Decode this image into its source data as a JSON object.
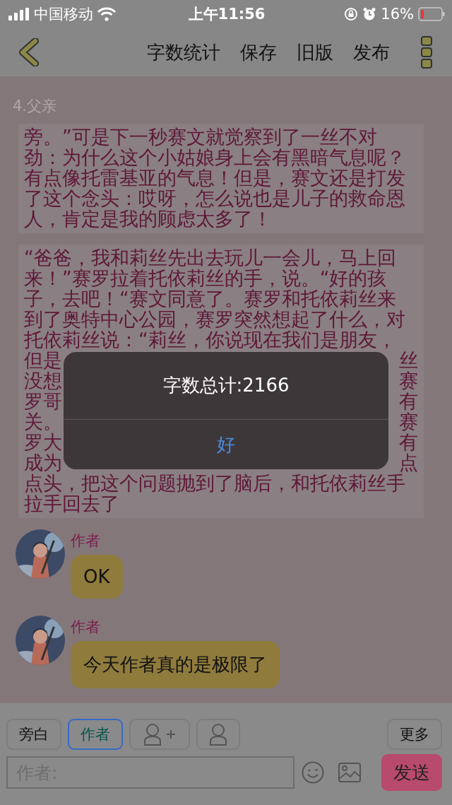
{
  "status_bar": {
    "carrier": "中国移动",
    "time": "上午11:56",
    "battery": "16%"
  },
  "toolbar": {
    "actions": [
      "字数统计",
      "保存",
      "旧版",
      "发布"
    ]
  },
  "chapter_title": "4.父亲",
  "paragraphs": [
    {
      "lines": [
        {
          "text": "旁。”可是下一秒赛文就觉察到了一丝不对"
        },
        {
          "text": "劲：为什么这个小姑娘身上会有黑暗气息呢？"
        },
        {
          "text": "有点像托雷基亚的气息！但是，赛文还是打发"
        },
        {
          "text": "了这个念头：哎呀，怎么说也是儿子的救命恩"
        },
        {
          "text": "人，肯定是我的顾虑太多了！"
        }
      ]
    },
    {
      "lines": [
        {
          "text": "“爸爸，我和莉丝先出去玩儿一会儿，马上回"
        },
        {
          "text": "来！”赛罗拉着托依莉丝的手，说。“好的孩"
        },
        {
          "text": "子，去吧！“赛文同意了。赛罗和托依莉丝来"
        },
        {
          "text": "到了奥特中心公园，赛罗突然想起了什么，对"
        },
        {
          "text": "托依莉丝说：“莉丝，你说现在我们是朋友，"
        },
        {
          "left": "但是",
          "right": "丝"
        },
        {
          "left": "没想",
          "right": "赛"
        },
        {
          "left": "罗哥",
          "right": "有"
        },
        {
          "left": "关。",
          "right": "赛"
        },
        {
          "left": "罗大",
          "right": "有"
        },
        {
          "left": "成为",
          "right": "点"
        },
        {
          "text": "点头，把这个问题抛到了脑后，和托依莉丝手"
        },
        {
          "text": "拉手回去了"
        }
      ]
    }
  ],
  "messages": [
    {
      "author": "作者",
      "text": "OK"
    },
    {
      "author": "作者",
      "text": "今天作者真的是极限了"
    }
  ],
  "roles": [
    {
      "label": "旁白",
      "selected": false
    },
    {
      "label": "作者",
      "selected": true
    }
  ],
  "more_button": "更多",
  "input": {
    "placeholder": "作者:"
  },
  "send_button": "发送",
  "alert": {
    "message": "字数总计:2166",
    "button": "好"
  }
}
